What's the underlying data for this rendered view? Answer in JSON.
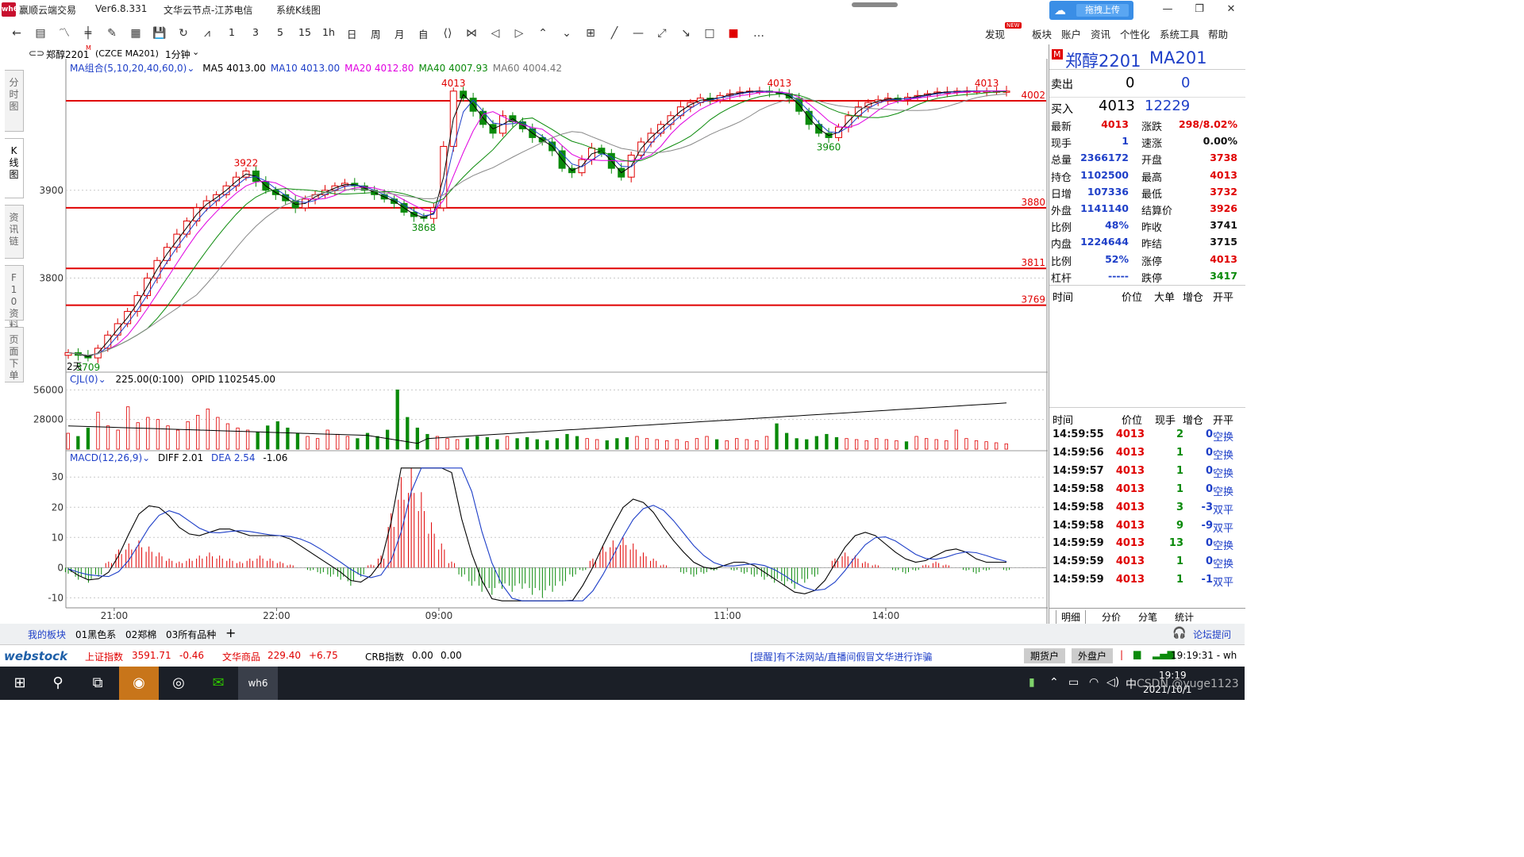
{
  "window": {
    "logo": "wh6",
    "app_name": "赢顺云端交易",
    "version": "Ver6.8.331",
    "node": "文华云节点-江苏电信",
    "view": "系统K线图",
    "upload_label": "拖拽上传"
  },
  "toolbar": {
    "periods": [
      "1",
      "3",
      "5",
      "15",
      "1h",
      "日",
      "周",
      "月",
      "自"
    ],
    "menu": [
      "发现",
      "板块",
      "账户",
      "资讯",
      "个性化",
      "系统工具",
      "帮助"
    ],
    "new_badge": "NEW"
  },
  "left_tabs": [
    "分时图",
    "K线图",
    "资讯链",
    "F10资料",
    "页面下单"
  ],
  "chart_header": {
    "instrument": "郑醇2201",
    "sup": "M",
    "code": "(CZCE MA201)",
    "interval": "1分钟"
  },
  "ma_legend": {
    "label": "MA组合(5,10,20,40,60,0)",
    "items": [
      {
        "text": "MA5 4013.00",
        "color": "#000000"
      },
      {
        "text": "MA10 4013.00",
        "color": "#1e3fc8"
      },
      {
        "text": "MA20 4012.80",
        "color": "#e000e0"
      },
      {
        "text": "MA40 4007.93",
        "color": "#0a8a0a"
      },
      {
        "text": "MA60 4004.42",
        "color": "#777777"
      }
    ]
  },
  "volume_legend": {
    "label": "CJL(0)",
    "v1": "225.00(0:100)",
    "v2": "OPID 1102545.00"
  },
  "macd_legend": {
    "label": "MACD(12,26,9)",
    "diff": "DIFF 2.01",
    "dea": "DEA 2.54",
    "macd": "-1.06"
  },
  "chart_data": {
    "type": "candlestick",
    "price_axis": {
      "min": 3700,
      "max": 4030,
      "ticks": [
        3900,
        3800
      ]
    },
    "volume_axis": {
      "ticks": [
        56000,
        28000
      ]
    },
    "macd_axis": {
      "min": -12,
      "max": 34,
      "ticks": [
        30,
        20,
        10,
        0,
        -10
      ]
    },
    "time_labels": [
      "21:00",
      "22:00",
      "09:00",
      "11:00",
      "14:00"
    ],
    "hlines": [
      {
        "value": 4002,
        "label": "4002"
      },
      {
        "value": 3880,
        "label": "3880"
      },
      {
        "value": 3811,
        "label": "3811"
      },
      {
        "value": 3769,
        "label": "3769"
      }
    ],
    "annotations": [
      {
        "label": "3709",
        "at": 3709,
        "place": "below"
      },
      {
        "label": "3922",
        "at": 3922,
        "place": "above"
      },
      {
        "label": "3868",
        "at": 3868,
        "place": "below"
      },
      {
        "label": "4013",
        "at": 4013,
        "place": "above"
      },
      {
        "label": "4013",
        "at": 4013,
        "place": "above"
      },
      {
        "label": "3960",
        "at": 3960,
        "place": "below"
      },
      {
        "label": "4013",
        "at": 4013,
        "place": "above"
      }
    ],
    "left_marker": "2天",
    "price_path": [
      3715,
      3712,
      3709,
      3720,
      3735,
      3748,
      3762,
      3780,
      3800,
      3820,
      3835,
      3850,
      3865,
      3880,
      3888,
      3895,
      3905,
      3915,
      3922,
      3910,
      3900,
      3895,
      3888,
      3880,
      3890,
      3895,
      3900,
      3905,
      3908,
      3905,
      3900,
      3895,
      3890,
      3885,
      3875,
      3870,
      3868,
      3880,
      3950,
      4013,
      4005,
      3990,
      3975,
      3965,
      3985,
      3978,
      3970,
      3960,
      3955,
      3945,
      3925,
      3920,
      3935,
      3948,
      3942,
      3925,
      3915,
      3940,
      3955,
      3965,
      3975,
      3985,
      3995,
      4000,
      4005,
      4003,
      4008,
      4010,
      4012,
      4013,
      4013,
      4012,
      4010,
      4005,
      3990,
      3975,
      3965,
      3960,
      3972,
      3985,
      3995,
      4000,
      4003,
      4005,
      4003,
      4006,
      4008,
      4010,
      4012,
      4012,
      4013,
      4013,
      4013,
      4013,
      4013,
      4013
    ],
    "volume_bars": [
      15,
      12,
      20,
      35,
      22,
      18,
      40,
      25,
      30,
      28,
      22,
      18,
      26,
      32,
      38,
      30,
      24,
      20,
      18,
      16,
      22,
      26,
      20,
      15,
      12,
      10,
      18,
      14,
      12,
      10,
      15,
      12,
      18,
      56,
      30,
      20,
      14,
      12,
      10,
      9,
      10,
      12,
      11,
      9,
      12,
      10,
      11,
      9,
      8,
      10,
      14,
      12,
      10,
      9,
      8,
      10,
      11,
      12,
      10,
      9,
      8,
      9,
      7,
      10,
      12,
      9,
      8,
      10,
      9,
      8,
      12,
      24,
      15,
      10,
      9,
      12,
      14,
      11,
      10,
      9,
      8,
      10,
      9,
      8,
      7,
      12,
      10,
      9,
      8,
      18,
      10,
      8,
      7,
      6,
      5
    ],
    "macd_bars": [
      -2,
      -4,
      -5,
      -3,
      2,
      6,
      8,
      9,
      7,
      5,
      3,
      2,
      3,
      4,
      5,
      4,
      3,
      2,
      3,
      4,
      3,
      2,
      1,
      0,
      -1,
      -2,
      -3,
      -4,
      -6,
      -3,
      1,
      4,
      18,
      30,
      33,
      25,
      15,
      8,
      2,
      -3,
      -6,
      -8,
      -9,
      -7,
      -8,
      -7,
      -9,
      -10,
      -8,
      -6,
      -3,
      -1,
      3,
      7,
      9,
      10,
      8,
      5,
      3,
      1,
      0,
      -2,
      -3,
      -2,
      -1,
      0,
      -1,
      -2,
      -3,
      -4,
      -5,
      -6,
      -7,
      -5,
      -3,
      0,
      3,
      5,
      4,
      2,
      1,
      0,
      -1,
      -2,
      -1,
      1,
      2,
      1,
      0,
      -1,
      -2,
      -1,
      0,
      -1
    ]
  },
  "quote": {
    "name": "郑醇2201",
    "code": "MA201",
    "ask_label": "卖出",
    "ask_price": "0",
    "ask_vol": "0",
    "bid_label": "买入",
    "bid_price": "4013",
    "bid_vol": "12229",
    "rows": [
      {
        "l1": "最新",
        "v1": "4013",
        "c1": "red",
        "l2": "涨跌",
        "v2": "298/8.02%",
        "c2": "red"
      },
      {
        "l1": "现手",
        "v1": "1",
        "c1": "blue",
        "l2": "速涨",
        "v2": "0.00%",
        "c2": "dark"
      },
      {
        "l1": "总量",
        "v1": "2366172",
        "c1": "blue",
        "l2": "开盘",
        "v2": "3738",
        "c2": "red"
      },
      {
        "l1": "持仓",
        "v1": "1102500",
        "c1": "blue",
        "l2": "最高",
        "v2": "4013",
        "c2": "red"
      },
      {
        "l1": "日增",
        "v1": "107336",
        "c1": "blue",
        "l2": "最低",
        "v2": "3732",
        "c2": "red"
      },
      {
        "l1": "外盘",
        "v1": "1141140",
        "c1": "blue",
        "l2": "结算价",
        "v2": "3926",
        "c2": "red"
      },
      {
        "l1": "比例",
        "v1": "48%",
        "c1": "blue",
        "l2": "昨收",
        "v2": "3741",
        "c2": "dark"
      },
      {
        "l1": "内盘",
        "v1": "1224644",
        "c1": "blue",
        "l2": "昨结",
        "v2": "3715",
        "c2": "dark"
      },
      {
        "l1": "比例",
        "v1": "52%",
        "c1": "blue",
        "l2": "涨停",
        "v2": "4013",
        "c2": "red"
      },
      {
        "l1": "杠杆",
        "v1": "-----",
        "c1": "blue",
        "l2": "跌停",
        "v2": "3417",
        "c2": "green"
      }
    ],
    "big_header": [
      "时间",
      "价位",
      "大单",
      "增仓",
      "开平"
    ],
    "tick_header": [
      "时间",
      "价位",
      "现手",
      "增仓",
      "开平"
    ],
    "ticks": [
      {
        "time": "14:59:55",
        "price": "4013",
        "vol": "2",
        "oi": "0",
        "type": "空换"
      },
      {
        "time": "14:59:56",
        "price": "4013",
        "vol": "1",
        "oi": "0",
        "type": "空换"
      },
      {
        "time": "14:59:57",
        "price": "4013",
        "vol": "1",
        "oi": "0",
        "type": "空换"
      },
      {
        "time": "14:59:58",
        "price": "4013",
        "vol": "1",
        "oi": "0",
        "type": "空换"
      },
      {
        "time": "14:59:58",
        "price": "4013",
        "vol": "3",
        "oi": "-3",
        "type": "双平"
      },
      {
        "time": "14:59:58",
        "price": "4013",
        "vol": "9",
        "oi": "-9",
        "type": "双平"
      },
      {
        "time": "14:59:59",
        "price": "4013",
        "vol": "13",
        "oi": "0",
        "type": "空换"
      },
      {
        "time": "14:59:59",
        "price": "4013",
        "vol": "1",
        "oi": "0",
        "type": "空换"
      },
      {
        "time": "14:59:59",
        "price": "4013",
        "vol": "1",
        "oi": "-1",
        "type": "双平"
      }
    ],
    "tabs": [
      "明细",
      "分价",
      "分笔",
      "统计"
    ]
  },
  "bottom_tabs": [
    "我的板块",
    "01黑色系",
    "02郑棉",
    "03所有品种",
    "+"
  ],
  "forum": "论坛提问",
  "ticker": {
    "brand": "webstock",
    "idx1_name": "上证指数",
    "idx1_val": "3591.71",
    "idx1_chg": "-0.46",
    "idx2_name": "文华商品",
    "idx2_val": "229.40",
    "idx2_chg": "+6.75",
    "idx3_name": "CRB指数",
    "idx3_val": "0.00",
    "idx3_chg": "0.00",
    "notice": "[提醒]有不法网站/直播间假冒文华进行诈骗",
    "btn1": "期货户",
    "btn2": "外盘户",
    "clock": "19:19:31 - wh"
  },
  "taskbar": {
    "time": "19:19",
    "date": "2021/10/1",
    "watermark": "CSDN @yuge1123",
    "ime": "中"
  }
}
